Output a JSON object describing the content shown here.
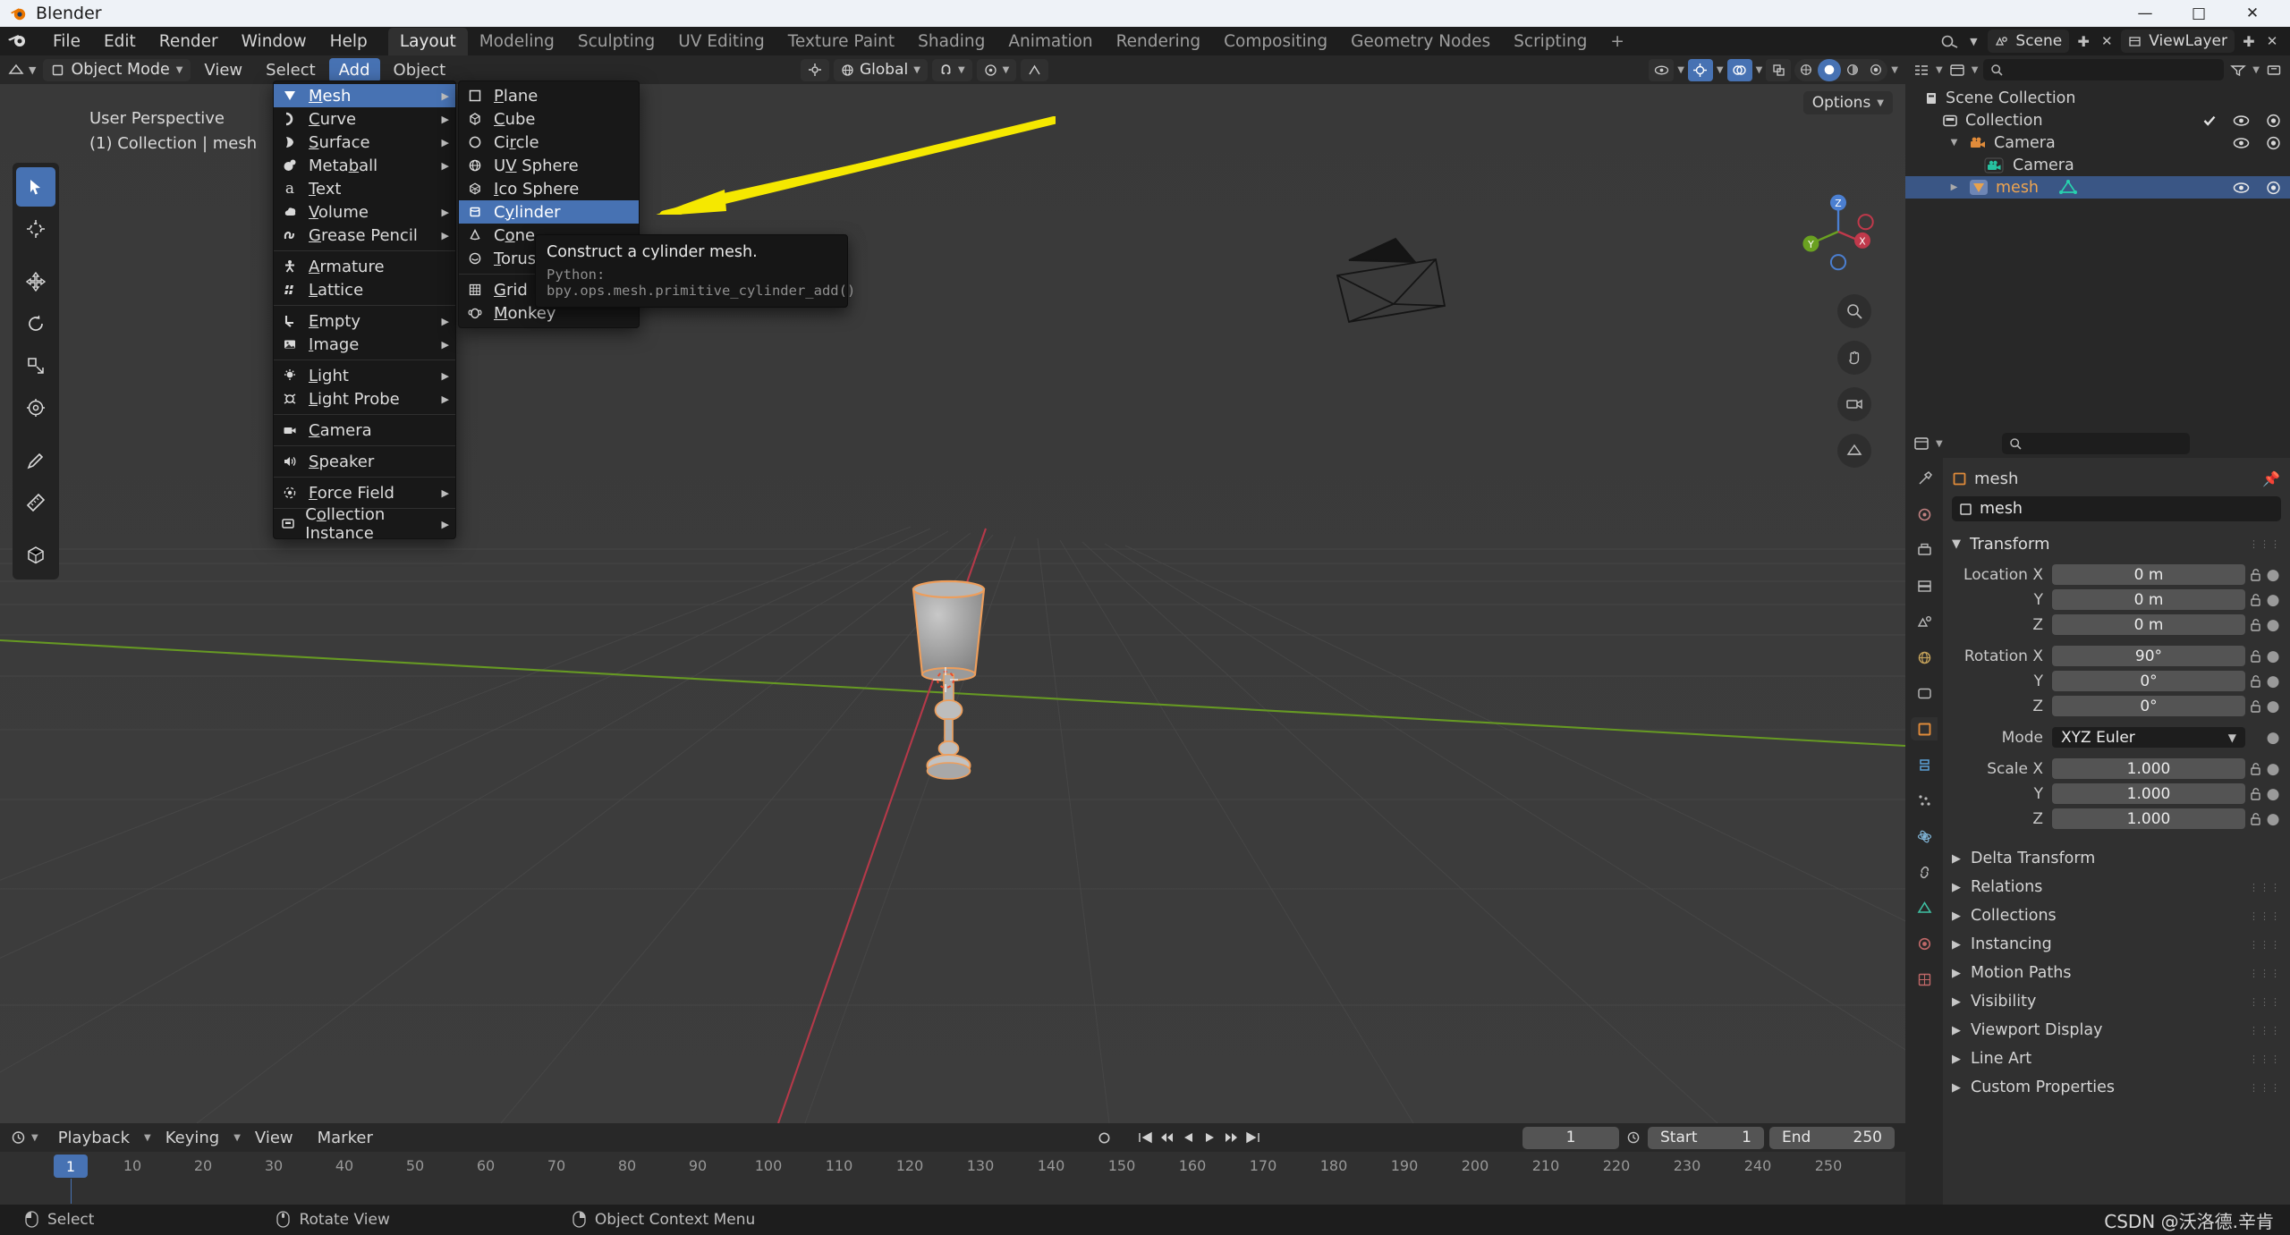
{
  "window": {
    "title": "Blender",
    "app_icon": "blender-logo-icon"
  },
  "topbar": {
    "menus": [
      "File",
      "Edit",
      "Render",
      "Window",
      "Help"
    ],
    "workspaces": [
      "Layout",
      "Modeling",
      "Sculpting",
      "UV Editing",
      "Texture Paint",
      "Shading",
      "Animation",
      "Rendering",
      "Compositing",
      "Geometry Nodes",
      "Scripting"
    ],
    "active_workspace": "Layout",
    "add_workspace_label": "+",
    "scene_name": "Scene",
    "viewlayer_name": "ViewLayer"
  },
  "viewport_header": {
    "mode": "Object Mode",
    "menus": [
      "View",
      "Select",
      "Add",
      "Object"
    ],
    "active_menu": "Add",
    "transform_orientation": "Global",
    "options_label": "Options"
  },
  "viewport": {
    "overlay_line1": "User Perspective",
    "overlay_line2": "(1) Collection | mesh",
    "axis_labels": {
      "x": "X",
      "y": "Y",
      "z": "Z"
    },
    "tools": [
      "tweak-select-tool",
      "cursor-tool",
      "move-tool",
      "rotate-tool",
      "scale-tool",
      "transform-tool",
      "annotate-tool",
      "measure-tool",
      "add-cube-tool"
    ]
  },
  "add_menu": {
    "items": [
      {
        "label": "Mesh",
        "icon": "mesh-icon",
        "submenu": true,
        "selected": true,
        "accel": 0
      },
      {
        "label": "Curve",
        "icon": "curve-icon",
        "submenu": true,
        "selected": false,
        "accel": 0
      },
      {
        "label": "Surface",
        "icon": "surface-icon",
        "submenu": true,
        "selected": false,
        "accel": 0
      },
      {
        "label": "Metaball",
        "icon": "metaball-icon",
        "submenu": true,
        "selected": false,
        "accel": 5
      },
      {
        "label": "Text",
        "icon": "text-icon",
        "submenu": false,
        "selected": false,
        "accel": 0
      },
      {
        "label": "Volume",
        "icon": "volume-icon",
        "submenu": true,
        "selected": false,
        "accel": 0
      },
      {
        "label": "Grease Pencil",
        "icon": "grease-pencil-icon",
        "submenu": true,
        "selected": false,
        "accel": 0
      },
      {
        "separator": true
      },
      {
        "label": "Armature",
        "icon": "armature-icon",
        "submenu": false,
        "selected": false,
        "accel": 0
      },
      {
        "label": "Lattice",
        "icon": "lattice-icon",
        "submenu": false,
        "selected": false,
        "accel": 0
      },
      {
        "separator": true
      },
      {
        "label": "Empty",
        "icon": "empty-icon",
        "submenu": true,
        "selected": false,
        "accel": 0
      },
      {
        "label": "Image",
        "icon": "image-icon",
        "submenu": true,
        "selected": false,
        "accel": 0
      },
      {
        "separator": true
      },
      {
        "label": "Light",
        "icon": "light-icon",
        "submenu": true,
        "selected": false,
        "accel": 0
      },
      {
        "label": "Light Probe",
        "icon": "light-probe-icon",
        "submenu": true,
        "selected": false,
        "accel": 0
      },
      {
        "separator": true
      },
      {
        "label": "Camera",
        "icon": "camera-icon",
        "submenu": false,
        "selected": false,
        "accel": 0
      },
      {
        "separator": true
      },
      {
        "label": "Speaker",
        "icon": "speaker-icon",
        "submenu": false,
        "selected": false,
        "accel": 0
      },
      {
        "separator": true
      },
      {
        "label": "Force Field",
        "icon": "force-field-icon",
        "submenu": true,
        "selected": false,
        "accel": 0
      },
      {
        "separator": true
      },
      {
        "label": "Collection Instance",
        "icon": "collection-instance-icon",
        "submenu": true,
        "selected": false,
        "accel": 0
      }
    ]
  },
  "mesh_submenu": {
    "items": [
      {
        "label": "Plane",
        "icon": "plane-icon",
        "selected": false,
        "accel": 0
      },
      {
        "label": "Cube",
        "icon": "cube-icon",
        "selected": false,
        "accel": 0
      },
      {
        "label": "Circle",
        "icon": "circle-icon",
        "selected": false,
        "accel": 3
      },
      {
        "label": "UV Sphere",
        "icon": "uv-sphere-icon",
        "selected": false,
        "accel": 1
      },
      {
        "label": "Ico Sphere",
        "icon": "ico-sphere-icon",
        "selected": false,
        "accel": 0
      },
      {
        "label": "Cylinder",
        "icon": "cylinder-icon",
        "selected": true,
        "accel": 2
      },
      {
        "label": "Cone",
        "icon": "cone-icon",
        "selected": false,
        "accel": 2
      },
      {
        "label": "Torus",
        "icon": "torus-icon",
        "selected": false,
        "accel": 0
      },
      {
        "separator": true
      },
      {
        "label": "Grid",
        "icon": "grid-icon",
        "selected": false,
        "accel": 0
      },
      {
        "label": "Monkey",
        "icon": "monkey-icon",
        "selected": false,
        "accel": 0
      }
    ]
  },
  "tooltip": {
    "title": "Construct a cylinder mesh.",
    "python": "Python: bpy.ops.mesh.primitive_cylinder_add()"
  },
  "outliner": {
    "search_placeholder": "",
    "rows": [
      {
        "label": "Scene Collection",
        "icon": "scene-collection-icon",
        "indent": 0,
        "selected": false,
        "disclosure": "",
        "checkbox": false,
        "eye": false,
        "camera": false
      },
      {
        "label": "Collection",
        "icon": "collection-icon",
        "indent": 1,
        "selected": false,
        "disclosure": "",
        "checkbox": true,
        "eye": true,
        "camera": true
      },
      {
        "label": "Camera",
        "icon": "camera-object-icon",
        "indent": 2,
        "selected": false,
        "disclosure": "▼",
        "checkbox": false,
        "eye": true,
        "camera": true
      },
      {
        "label": "Camera",
        "icon": "camera-data-icon",
        "indent": 4,
        "selected": false,
        "disclosure": "",
        "checkbox": false,
        "eye": false,
        "camera": false
      },
      {
        "label": "mesh",
        "icon": "mesh-object-icon",
        "indent": 2,
        "selected": true,
        "disclosure": "▶",
        "checkbox": false,
        "eye": true,
        "camera": true
      }
    ]
  },
  "properties": {
    "breadcrumb_object": "mesh",
    "object_name": "mesh",
    "panel_title": "Transform",
    "fields": [
      {
        "label": "Location X",
        "value": "0 m",
        "lock": true
      },
      {
        "label": "Y",
        "value": "0 m",
        "lock": true
      },
      {
        "label": "Z",
        "value": "0 m",
        "lock": true
      },
      {
        "label": "Rotation X",
        "value": "90°",
        "lock": true
      },
      {
        "label": "Y",
        "value": "0°",
        "lock": true
      },
      {
        "label": "Z",
        "value": "0°",
        "lock": true
      },
      {
        "label": "Mode",
        "value": "XYZ Euler",
        "lock": false,
        "dropdown": true
      },
      {
        "label": "Scale X",
        "value": "1.000",
        "lock": true
      },
      {
        "label": "Y",
        "value": "1.000",
        "lock": true
      },
      {
        "label": "Z",
        "value": "1.000",
        "lock": true
      }
    ],
    "sub_panels": [
      "Delta Transform",
      "Relations",
      "Collections",
      "Instancing",
      "Motion Paths",
      "Visibility",
      "Viewport Display",
      "Line Art",
      "Custom Properties"
    ],
    "tabs": [
      "tool-tab",
      "render-tab",
      "output-tab",
      "view-layer-tab",
      "scene-tab",
      "world-tab",
      "collection-tab",
      "object-tab",
      "modifiers-tab",
      "particles-tab",
      "physics-tab",
      "constraints-tab",
      "data-tab",
      "material-tab",
      "texture-tab"
    ]
  },
  "timeline": {
    "menus": [
      "Playback",
      "Keying",
      "View",
      "Marker"
    ],
    "current_frame": "1",
    "start_label": "Start",
    "start_value": "1",
    "end_label": "End",
    "end_value": "250",
    "playhead_frame": "1",
    "ticks": [
      "10",
      "20",
      "30",
      "40",
      "50",
      "60",
      "70",
      "80",
      "90",
      "100",
      "110",
      "120",
      "130",
      "140",
      "150",
      "160",
      "170",
      "180",
      "190",
      "200",
      "210",
      "220",
      "230",
      "240",
      "250"
    ]
  },
  "statusbar": {
    "items": [
      {
        "icon": "mouse-left-icon",
        "label": "Select"
      },
      {
        "icon": "mouse-middle-icon",
        "label": "Rotate View"
      },
      {
        "icon": "mouse-right-icon",
        "label": "Object Context Menu"
      }
    ],
    "credit": "CSDN @沃洛德.辛肯"
  },
  "colors": {
    "accent": "#4772b3",
    "selected_object": "#ed9e5c",
    "x_axis": "#c0394b",
    "y_axis": "#6aa121",
    "highlight_arrow": "#f5e800"
  }
}
